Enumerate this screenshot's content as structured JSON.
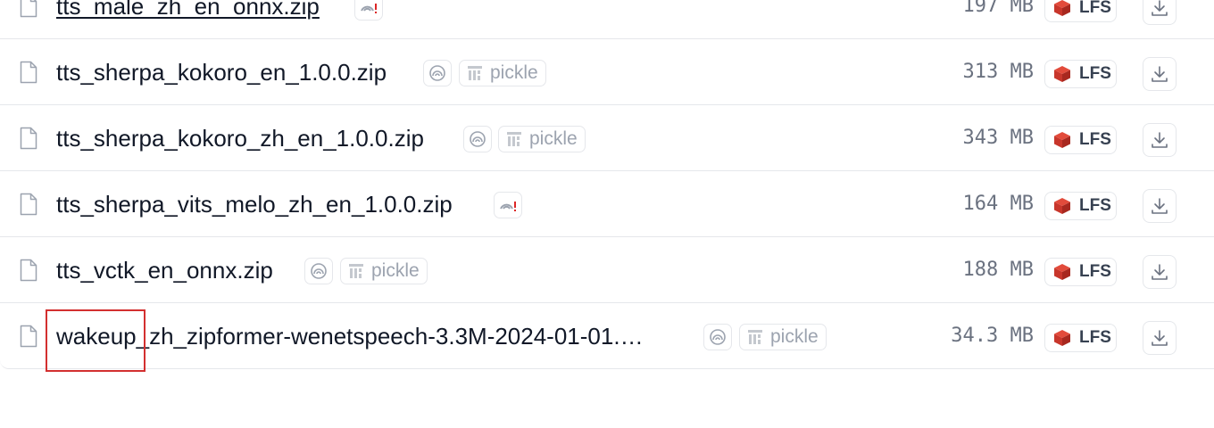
{
  "files": [
    {
      "name": "tts_male_zh_en_onnx.zip",
      "scan": "warning",
      "pickle": null,
      "size": "197 MB",
      "lfs": "LFS",
      "underlined": true
    },
    {
      "name": "tts_sherpa_kokoro_en_1.0.0.zip",
      "scan": "ok",
      "pickle": "pickle",
      "size": "313 MB",
      "lfs": "LFS",
      "underlined": false
    },
    {
      "name": "tts_sherpa_kokoro_zh_en_1.0.0.zip",
      "scan": "ok",
      "pickle": "pickle",
      "size": "343 MB",
      "lfs": "LFS",
      "underlined": false
    },
    {
      "name": "tts_sherpa_vits_melo_zh_en_1.0.0.zip",
      "scan": "warning",
      "pickle": null,
      "size": "164 MB",
      "lfs": "LFS",
      "underlined": false
    },
    {
      "name": "tts_vctk_en_onnx.zip",
      "scan": "ok",
      "pickle": "pickle",
      "size": "188 MB",
      "lfs": "LFS",
      "underlined": false
    },
    {
      "name": "wakeup_zh_zipformer-wenetspeech-3.3M-2024-01-01.…",
      "scan": "ok",
      "pickle": "pickle",
      "size": "34.3 MB",
      "lfs": "LFS",
      "underlined": false
    }
  ],
  "colors": {
    "lfs_icon": "#c8362b",
    "warning": "#dc2626",
    "highlight": "#d32f2f",
    "border": "#e5e7eb"
  },
  "icons": {
    "file": "file-icon",
    "scan": "security-scan-icon",
    "pickle": "pickle-icon",
    "lfs": "lfs-icon",
    "download": "download-icon"
  }
}
